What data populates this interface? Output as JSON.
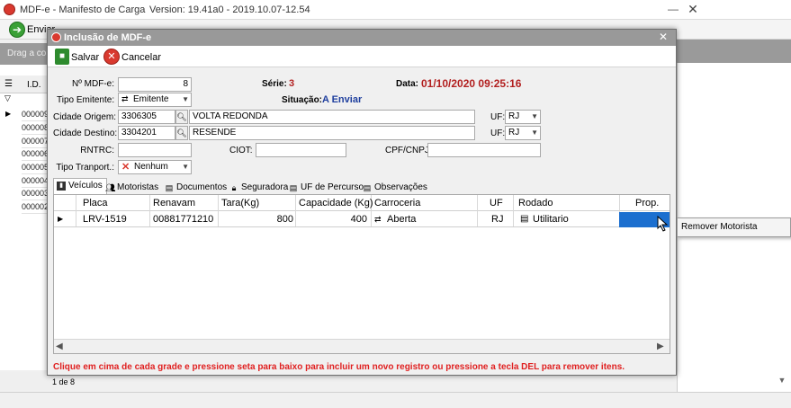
{
  "main_window": {
    "title": "MDF-e - Manifesto de Carga",
    "version": "Version: 19.41a0 - 2019.10.07-12.54",
    "toolbar": {
      "enviar_label": "Enviar"
    },
    "group_hint": "Drag a colu",
    "grid": {
      "id_header": "I.D.",
      "rows": [
        "000009",
        "000008",
        "000007",
        "000006",
        "000005",
        "000004",
        "000003",
        "000002"
      ]
    },
    "pager": {
      "text": "1 de 8"
    }
  },
  "dialog": {
    "title": "Inclusão de MDF-e",
    "toolbar": {
      "save_label": "Salvar",
      "cancel_label": "Cancelar"
    },
    "form": {
      "nro_mdfe_label": "Nº MDF-e:",
      "nro_mdfe_value": "8",
      "serie_label": "Série:",
      "serie_value": "3",
      "data_label": "Data:",
      "data_value": "01/10/2020 09:25:16",
      "tipo_emitente_label": "Tipo Emitente:",
      "tipo_emitente_value": "Emitente",
      "situacao_label": "Situação:",
      "situacao_value": "A Enviar",
      "cidade_origem_label": "Cidade Origem:",
      "cidade_origem_code": "3306305",
      "cidade_origem_name": "VOLTA REDONDA",
      "uf_origem_label": "UF:",
      "uf_origem_value": "RJ",
      "cidade_destino_label": "Cidade Destino:",
      "cidade_destino_code": "3304201",
      "cidade_destino_name": "RESENDE",
      "uf_destino_label": "UF:",
      "uf_destino_value": "RJ",
      "rntrc_label": "RNTRC:",
      "rntrc_value": "",
      "ciot_label": "CIOT:",
      "ciot_value": "",
      "cpf_cnpj_label": "CPF/CNPJ:",
      "cpf_cnpj_value": "",
      "tipo_transport_label": "Tipo Tranport.:",
      "tipo_transport_value": "Nenhum"
    },
    "tabs": [
      {
        "label": "Veículos"
      },
      {
        "label": "Motoristas"
      },
      {
        "label": "Documentos"
      },
      {
        "label": "Seguradora"
      },
      {
        "label": "UF de Percurso"
      },
      {
        "label": "Observações"
      }
    ],
    "vehicles_grid": {
      "headers": [
        "Placa",
        "Renavam",
        "Tara(Kg)",
        "Capacidade (Kg)",
        "Carroceria",
        "UF",
        "Rodado",
        "Prop."
      ],
      "rows": [
        {
          "placa": "LRV-1519",
          "renavam": "00881771210",
          "tara": "800",
          "capacidade": "400",
          "carroceria": "Aberta",
          "uf": "RJ",
          "rodado": "Utilitario",
          "prop": ""
        }
      ]
    },
    "footer_message": "Clique em cima de cada grade e pressione seta para baixo para incluir um novo registro ou pressione a tecla DEL para remover itens."
  },
  "context_menu": {
    "items": [
      {
        "label": "Remover Motorista"
      }
    ]
  },
  "colors": {
    "highlight_red": "#b21f1f",
    "status_blue": "#1f3f9e",
    "footer_red": "#e02020",
    "selection_blue": "#1c6fcf"
  }
}
